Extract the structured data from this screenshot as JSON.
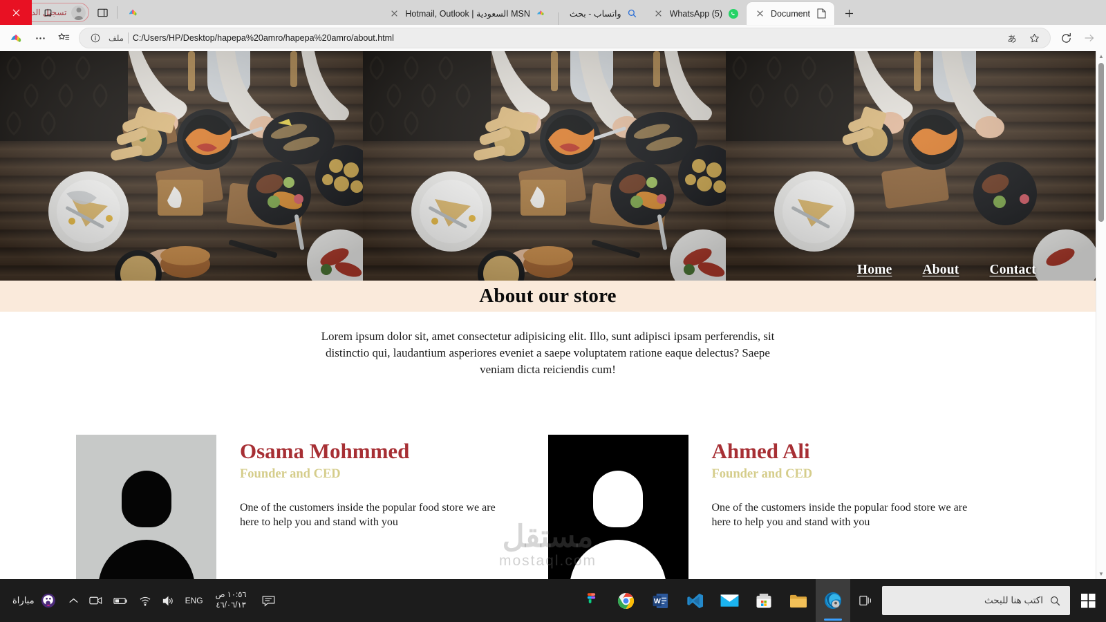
{
  "window": {
    "controls": {
      "close": "✕",
      "maximize": "▢",
      "minimize": "—"
    },
    "new_tab_label": "+"
  },
  "tabs": [
    {
      "title": "Document",
      "favicon": "document-icon",
      "active": true,
      "close": "✕"
    },
    {
      "title": "(5) WhatsApp",
      "favicon": "whatsapp-icon",
      "active": false,
      "close": "✕"
    },
    {
      "title": "واتساب - بحث",
      "favicon": "search-icon",
      "active": false,
      "close": ""
    },
    {
      "title": "MSN السعودية | Hotmail, Outlook",
      "favicon": "msn-icon",
      "active": false,
      "close": "✕"
    }
  ],
  "tabstrip_actions": {
    "copilot_label": "copilot-icon",
    "split_screen_label": "split-screen-icon",
    "signin_label": "تسجيل الدخول"
  },
  "toolbar": {
    "copilot": "copilot-icon",
    "more": "…",
    "collections": "collections-icon",
    "favorite": "☆",
    "read_aloud": "あ",
    "file_scheme_label": "ملف",
    "info_icon": "ⓘ",
    "url": "C:/Users/HP/Desktop/hapepa%20amro/hapepa%20amro/about.html",
    "refresh": "refresh-icon",
    "forward": "→"
  },
  "page": {
    "nav": [
      {
        "label": "Home",
        "href": "index.html"
      },
      {
        "label": "About",
        "href": "about.html"
      },
      {
        "label": "Contact",
        "href": "contact.html"
      }
    ],
    "banner_title": "About our store",
    "intro": "Lorem ipsum dolor sit, amet consectetur adipisicing elit. Illo, sunt adipisci ipsam perferendis, sit distinctio qui, laudantium asperiores eveniet a saepe voluptatem ratione eaque delectus? Saepe veniam dicta reiciendis cum!",
    "team": [
      {
        "name": "Osama Mohmmed",
        "role": "Founder and CED",
        "bio": "One of the customers inside the popular food store we are here to help you and stand with you",
        "photo_style": "light",
        "photo_alt": "person-placeholder-icon"
      },
      {
        "name": "Ahmed Ali",
        "role": "Founder and CED",
        "bio": "One of the customers inside the popular food store we are here to help you and stand with you",
        "photo_style": "dark",
        "photo_alt": "person-placeholder-icon"
      }
    ],
    "watermark": {
      "arabic": "مستقل",
      "latin": "mostaql.com"
    }
  },
  "colors": {
    "banner_bg": "#faeadb",
    "name_red": "#a72f34",
    "role_khaki": "#d5cd8b",
    "signin_border": "#d88f94",
    "taskbar_bg": "#1c1c1c"
  },
  "taskbar": {
    "search_placeholder": "اكتب هنا للبحث",
    "start": "start-icon",
    "task_view": "task-view-icon",
    "apps": [
      {
        "name": "edge-icon",
        "active": true
      },
      {
        "name": "file-explorer-icon",
        "active": false
      },
      {
        "name": "microsoft-store-icon",
        "active": false
      },
      {
        "name": "mail-icon",
        "active": false
      },
      {
        "name": "vscode-icon",
        "active": false
      },
      {
        "name": "word-icon",
        "active": false
      },
      {
        "name": "chrome-icon",
        "active": false
      },
      {
        "name": "figma-icon",
        "active": false
      }
    ],
    "tray": {
      "match_label": "مباراة",
      "chevron": "⌃",
      "language": "ENG",
      "time": "١٠:٥٦ ص",
      "date": "٤٦/٠٦/١٣"
    }
  }
}
